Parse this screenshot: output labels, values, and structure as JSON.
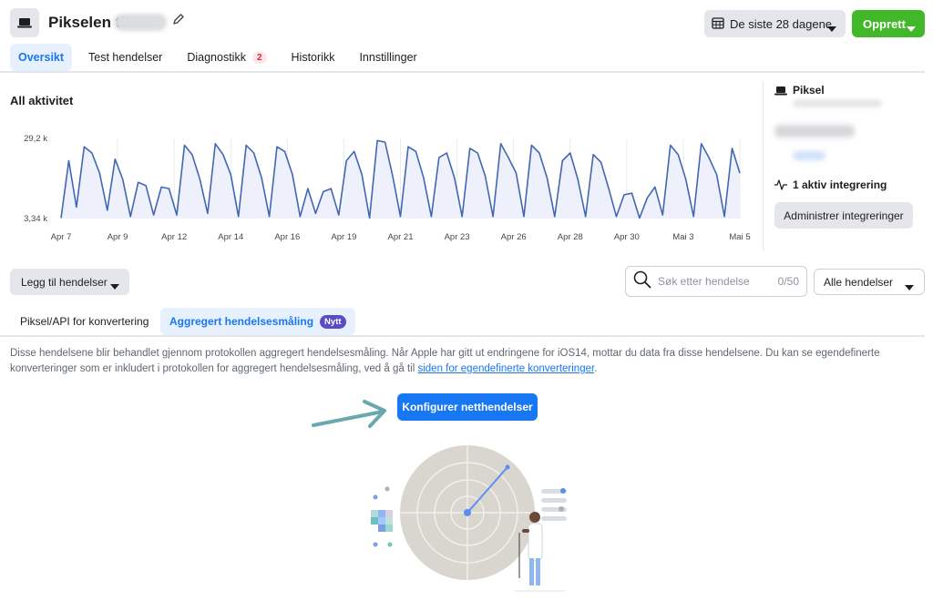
{
  "header": {
    "title": "Pikselen til",
    "date_range": "De siste 28 dagene",
    "create_label": "Opprett"
  },
  "tabs": [
    {
      "label": "Oversikt",
      "active": true
    },
    {
      "label": "Test hendelser"
    },
    {
      "label": "Diagnostikk",
      "badge": "2"
    },
    {
      "label": "Historikk"
    },
    {
      "label": "Innstillinger"
    }
  ],
  "activity": {
    "title": "All aktivitet"
  },
  "chart_data": {
    "type": "line",
    "title": "All aktivitet",
    "y_ticks": [
      "29,2 k",
      "3,34 k"
    ],
    "ylim": [
      3340,
      29200
    ],
    "x_ticks": [
      "Apr 7",
      "Apr 9",
      "Apr 12",
      "Apr 14",
      "Apr 16",
      "Apr 19",
      "Apr 21",
      "Apr 23",
      "Apr 26",
      "Apr 28",
      "Apr 30",
      "Mai 3",
      "Mai 5"
    ],
    "values": [
      3500,
      22000,
      7000,
      26500,
      24500,
      18000,
      6000,
      22500,
      16000,
      4000,
      15000,
      14000,
      4500,
      13500,
      13000,
      4500,
      27000,
      24000,
      16000,
      5000,
      27500,
      24000,
      17500,
      4000,
      27000,
      24500,
      16500,
      4000,
      26500,
      25000,
      17500,
      4000,
      13000,
      5000,
      12000,
      13000,
      4500,
      22000,
      25000,
      17500,
      3500,
      28500,
      28000,
      17000,
      4000,
      26500,
      25000,
      16500,
      4000,
      23000,
      24500,
      16500,
      4000,
      26000,
      24500,
      17000,
      4000,
      27500,
      23000,
      18000,
      4000,
      27000,
      24500,
      16500,
      4000,
      22000,
      24500,
      16000,
      4000,
      24000,
      21500,
      13000,
      4000,
      11000,
      11500,
      3500,
      10000,
      13500,
      4500,
      27000,
      24000,
      16000,
      4000,
      27500,
      23000,
      17500,
      4000,
      26000,
      18000
    ],
    "grid": true
  },
  "panel": {
    "pixel_label": "Piksel",
    "integration_label": "1 aktiv integrering",
    "manage_label": "Administrer integreringer"
  },
  "controls": {
    "add_events_label": "Legg til hendelser",
    "search_placeholder": "Søk etter hendelse",
    "search_count": "0/50",
    "filter_label": "Alle hendelser"
  },
  "subtabs": [
    {
      "label": "Piksel/API for konvertering"
    },
    {
      "label": "Aggregert hendelsesmåling",
      "badge": "Nytt",
      "active": true
    }
  ],
  "description": {
    "text_part1": "Disse hendelsene blir behandlet gjennom protokollen aggregert hendelsesmåling. Når Apple har gitt ut endringene for iOS14, mottar du data fra disse hendelsene. Du kan se egendefinerte konverteringer som er inkludert i protokollen for aggregert hendelsesmåling, ved å gå til ",
    "link_text": "siden for egendefinerte konverteringer",
    "text_part2": "."
  },
  "configure_label": "Konfigurer netthendelser",
  "colors": {
    "primary": "#1877f2",
    "create": "#42b72a",
    "chart_line": "#4267b2",
    "chart_fill": "#eef1fb",
    "badge_new": "#5b4bc4"
  }
}
